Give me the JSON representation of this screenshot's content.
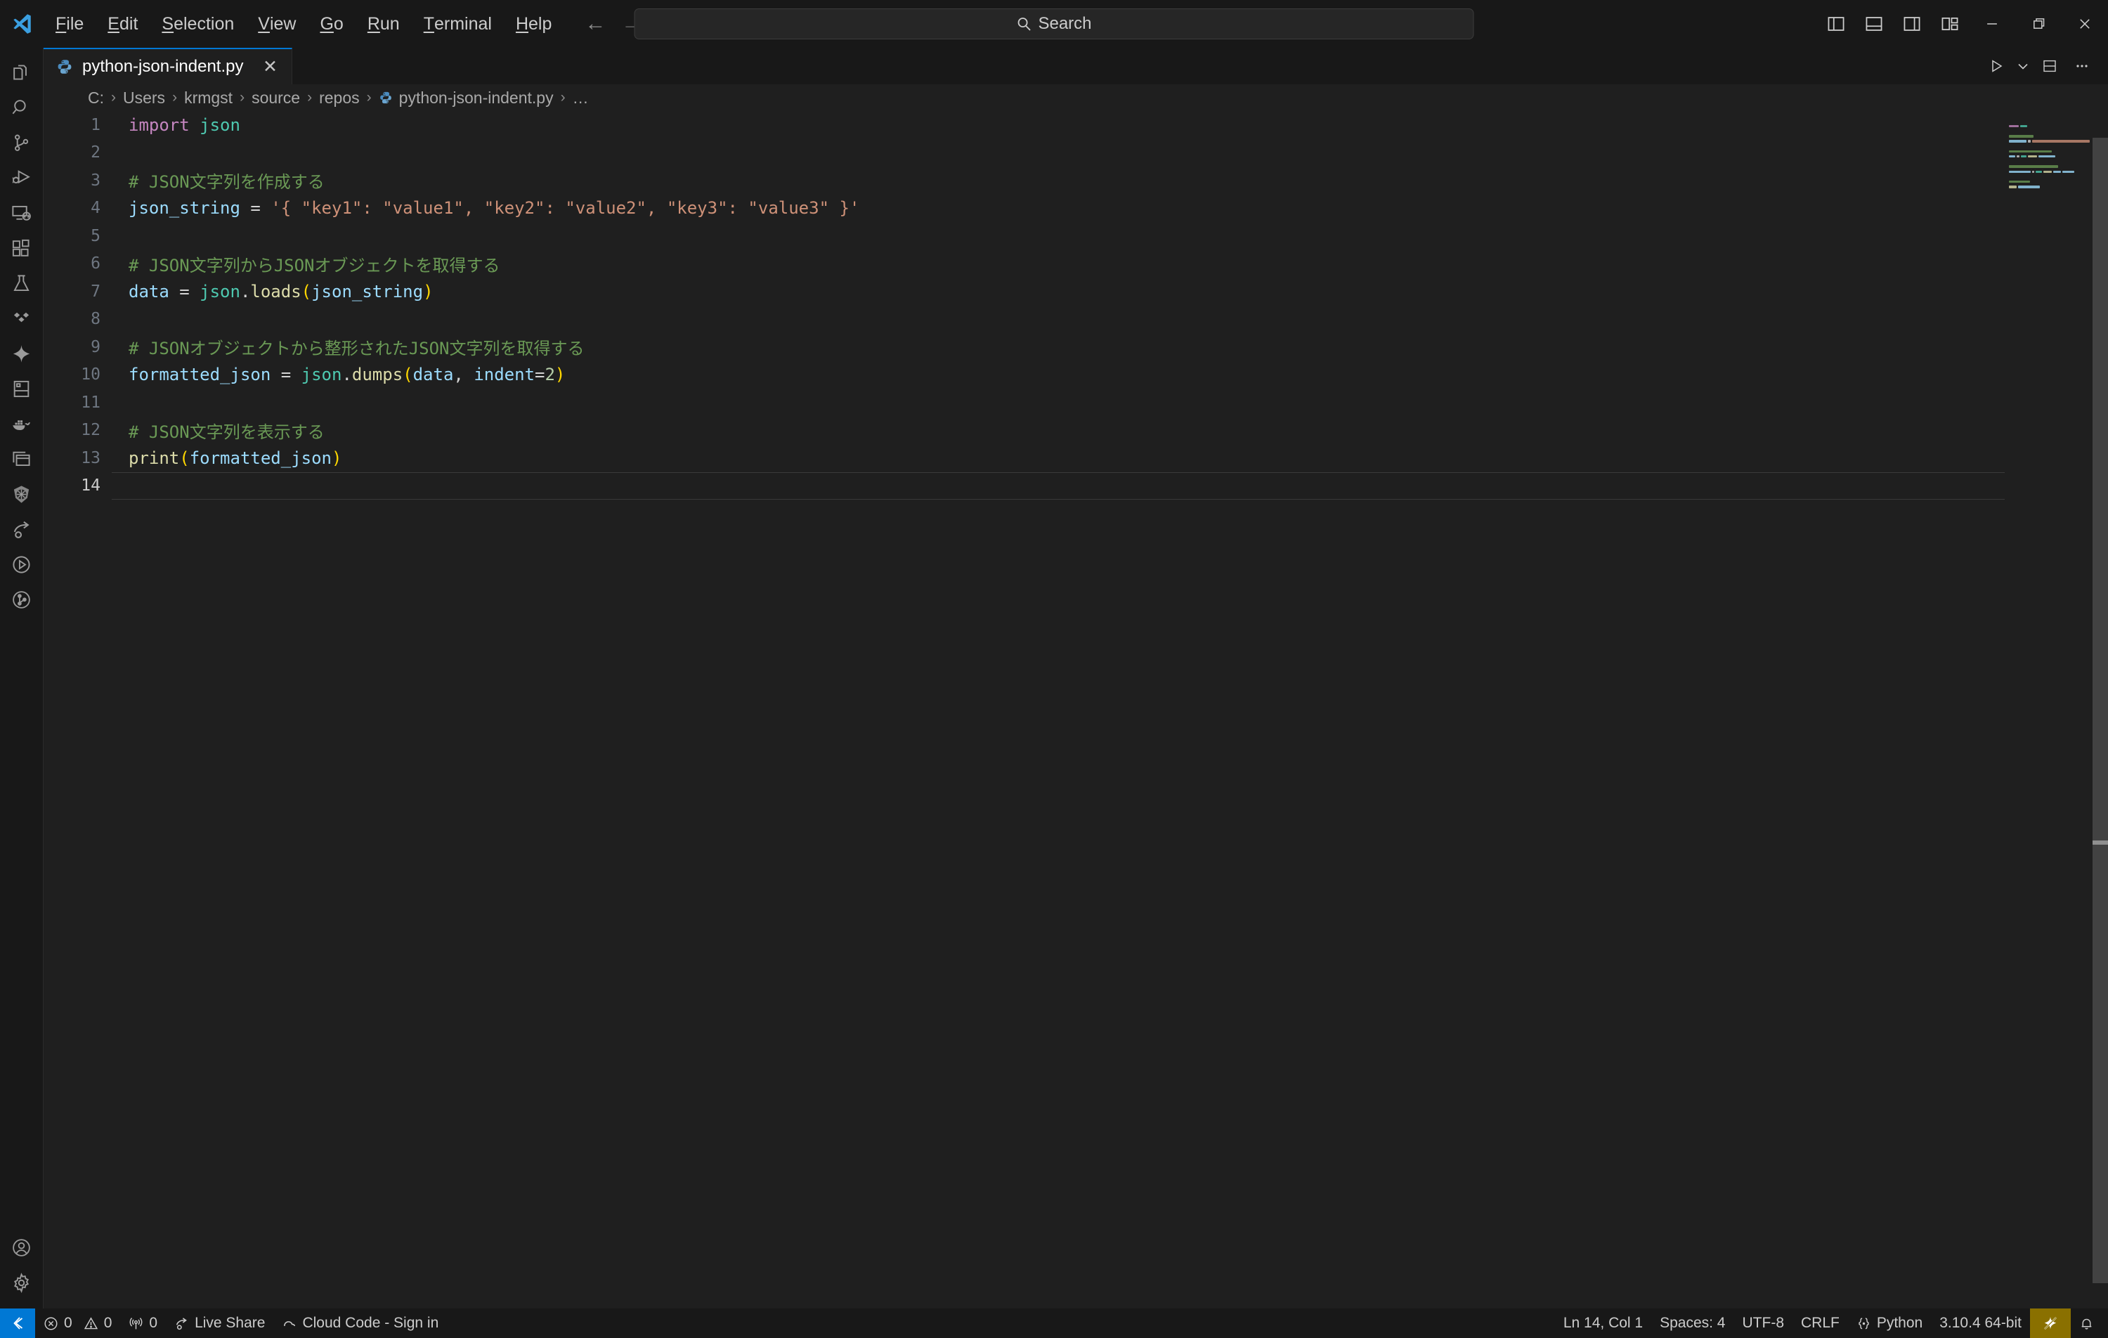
{
  "titlebar": {
    "logo_icon": "vscode-logo-icon",
    "menus": [
      {
        "label": "File",
        "mnemonic": "F"
      },
      {
        "label": "Edit",
        "mnemonic": "E"
      },
      {
        "label": "Selection",
        "mnemonic": "S"
      },
      {
        "label": "View",
        "mnemonic": "V"
      },
      {
        "label": "Go",
        "mnemonic": "G"
      },
      {
        "label": "Run",
        "mnemonic": "R"
      },
      {
        "label": "Terminal",
        "mnemonic": "T"
      },
      {
        "label": "Help",
        "mnemonic": "H"
      }
    ],
    "nav": {
      "back_icon": "arrow-left-icon",
      "forward_icon": "arrow-right-icon"
    },
    "search": {
      "placeholder": "Search",
      "icon": "search-icon"
    },
    "layout_buttons": [
      {
        "name": "toggle-primary-sidebar-icon",
        "tooltip": "Toggle Primary Side Bar"
      },
      {
        "name": "toggle-panel-icon",
        "tooltip": "Toggle Panel"
      },
      {
        "name": "toggle-secondary-sidebar-icon",
        "tooltip": "Toggle Secondary Side Bar"
      },
      {
        "name": "customize-layout-icon",
        "tooltip": "Customize Layout"
      }
    ],
    "window_controls": [
      {
        "name": "minimize-button",
        "glyph": "minimize"
      },
      {
        "name": "restore-button",
        "glyph": "restore"
      },
      {
        "name": "close-button",
        "glyph": "close"
      }
    ]
  },
  "activitybar": {
    "items": [
      {
        "name": "explorer",
        "icon": "files-icon"
      },
      {
        "name": "search",
        "icon": "search-icon"
      },
      {
        "name": "source-control",
        "icon": "source-control-icon"
      },
      {
        "name": "run-and-debug",
        "icon": "run-debug-icon"
      },
      {
        "name": "remote-explorer",
        "icon": "remote-explorer-icon"
      },
      {
        "name": "extensions",
        "icon": "extensions-icon"
      },
      {
        "name": "testing",
        "icon": "beaker-icon"
      },
      {
        "name": "azure",
        "icon": "azure-icon"
      },
      {
        "name": "copilot-chat",
        "icon": "sparkle-icon"
      },
      {
        "name": "database",
        "icon": "database-icon"
      },
      {
        "name": "docker",
        "icon": "docker-whale-icon"
      },
      {
        "name": "remote-windows",
        "icon": "windows-stack-icon"
      },
      {
        "name": "kubernetes",
        "icon": "kubernetes-helm-icon"
      },
      {
        "name": "live-share",
        "icon": "live-share-icon"
      },
      {
        "name": "test-coverage",
        "icon": "play-circle-icon"
      },
      {
        "name": "gitlens",
        "icon": "gitlens-icon"
      }
    ],
    "bottom_items": [
      {
        "name": "accounts",
        "icon": "account-icon"
      },
      {
        "name": "manage",
        "icon": "gear-icon"
      }
    ]
  },
  "tabbar": {
    "tabs": [
      {
        "label": "python-json-indent.py",
        "icon": "python-file-icon",
        "active": true,
        "close_icon": "close-icon"
      }
    ],
    "actions": [
      {
        "name": "run-python-file-button",
        "icon": "play-icon"
      },
      {
        "name": "run-options-dropdown",
        "icon": "chevron-down-icon"
      },
      {
        "name": "split-editor-button",
        "icon": "split-editor-down-icon"
      },
      {
        "name": "more-actions-button",
        "icon": "ellipsis-icon"
      }
    ]
  },
  "breadcrumb": {
    "separator": "›",
    "items": [
      {
        "label": "C:",
        "icon": null
      },
      {
        "label": "Users",
        "icon": null
      },
      {
        "label": "krmgst",
        "icon": null
      },
      {
        "label": "source",
        "icon": null
      },
      {
        "label": "repos",
        "icon": null
      },
      {
        "label": "python-json-indent.py",
        "icon": "python-file-icon"
      },
      {
        "label": "…",
        "icon": null
      }
    ]
  },
  "editor": {
    "language": "python",
    "active_line": 14,
    "lines": [
      {
        "n": 1,
        "tokens": [
          {
            "t": "import",
            "c": "kw"
          },
          {
            "t": " ",
            "c": "plain"
          },
          {
            "t": "json",
            "c": "mod"
          }
        ]
      },
      {
        "n": 2,
        "tokens": []
      },
      {
        "n": 3,
        "tokens": [
          {
            "t": "# JSON文字列を作成する",
            "c": "cmt"
          }
        ]
      },
      {
        "n": 4,
        "tokens": [
          {
            "t": "json_string",
            "c": "var"
          },
          {
            "t": " ",
            "c": "plain"
          },
          {
            "t": "=",
            "c": "op"
          },
          {
            "t": " ",
            "c": "plain"
          },
          {
            "t": "'{ \"key1\": \"value1\", \"key2\": \"value2\", \"key3\": \"value3\" }'",
            "c": "str"
          }
        ]
      },
      {
        "n": 5,
        "tokens": []
      },
      {
        "n": 6,
        "tokens": [
          {
            "t": "# JSON文字列からJSONオブジェクトを取得する",
            "c": "cmt"
          }
        ]
      },
      {
        "n": 7,
        "tokens": [
          {
            "t": "data",
            "c": "var"
          },
          {
            "t": " ",
            "c": "plain"
          },
          {
            "t": "=",
            "c": "op"
          },
          {
            "t": " ",
            "c": "plain"
          },
          {
            "t": "json",
            "c": "mod"
          },
          {
            "t": ".",
            "c": "plain"
          },
          {
            "t": "loads",
            "c": "fn"
          },
          {
            "t": "(",
            "c": "br"
          },
          {
            "t": "json_string",
            "c": "var"
          },
          {
            "t": ")",
            "c": "br"
          }
        ]
      },
      {
        "n": 8,
        "tokens": []
      },
      {
        "n": 9,
        "tokens": [
          {
            "t": "# JSONオブジェクトから整形されたJSON文字列を取得する",
            "c": "cmt"
          }
        ]
      },
      {
        "n": 10,
        "tokens": [
          {
            "t": "formatted_json",
            "c": "var"
          },
          {
            "t": " ",
            "c": "plain"
          },
          {
            "t": "=",
            "c": "op"
          },
          {
            "t": " ",
            "c": "plain"
          },
          {
            "t": "json",
            "c": "mod"
          },
          {
            "t": ".",
            "c": "plain"
          },
          {
            "t": "dumps",
            "c": "fn"
          },
          {
            "t": "(",
            "c": "br"
          },
          {
            "t": "data",
            "c": "var"
          },
          {
            "t": ", ",
            "c": "plain"
          },
          {
            "t": "indent",
            "c": "var"
          },
          {
            "t": "=",
            "c": "op"
          },
          {
            "t": "2",
            "c": "num"
          },
          {
            "t": ")",
            "c": "br"
          }
        ]
      },
      {
        "n": 11,
        "tokens": []
      },
      {
        "n": 12,
        "tokens": [
          {
            "t": "# JSON文字列を表示する",
            "c": "cmt"
          }
        ]
      },
      {
        "n": 13,
        "tokens": [
          {
            "t": "print",
            "c": "fn"
          },
          {
            "t": "(",
            "c": "br"
          },
          {
            "t": "formatted_json",
            "c": "var"
          },
          {
            "t": ")",
            "c": "br"
          }
        ]
      },
      {
        "n": 14,
        "tokens": []
      }
    ]
  },
  "statusbar": {
    "left": [
      {
        "name": "remote-host-indicator",
        "label": "",
        "icon": "remote-icon"
      },
      {
        "name": "problems-errors",
        "label": "0",
        "icon": "error-icon"
      },
      {
        "name": "problems-warnings",
        "label": "0",
        "icon": "warning-icon"
      },
      {
        "name": "ports-forwarded",
        "label": "0",
        "icon": "radio-tower-icon"
      },
      {
        "name": "live-share",
        "label": "Live Share",
        "icon": "live-share-icon"
      },
      {
        "name": "cloud-code",
        "label": "Cloud Code - Sign in",
        "icon": "cloud-icon"
      }
    ],
    "right": [
      {
        "name": "cursor-position",
        "label": "Ln 14, Col 1"
      },
      {
        "name": "indentation",
        "label": "Spaces: 4"
      },
      {
        "name": "encoding",
        "label": "UTF-8"
      },
      {
        "name": "eol-sequence",
        "label": "CRLF"
      },
      {
        "name": "language-mode",
        "label": "Python",
        "icon": "python-brackets-icon"
      },
      {
        "name": "python-interpreter",
        "label": "3.10.4 64-bit"
      },
      {
        "name": "copilot-status",
        "label": "",
        "icon": "copilot-disabled-icon"
      },
      {
        "name": "notifications",
        "label": "",
        "icon": "bell-icon"
      }
    ]
  },
  "colors": {
    "accent": "#0078d4",
    "titlebar_bg": "#181818",
    "editor_bg": "#1f1f1f",
    "copilot_warning_bg": "#8a7000"
  },
  "minimap": {
    "rows": [
      [
        {
          "w": 34,
          "color": "#c586c0"
        },
        {
          "w": 22,
          "color": "#4ec9b0"
        }
      ],
      [],
      [
        {
          "w": 84,
          "color": "#6a9955"
        }
      ],
      [
        {
          "w": 60,
          "color": "#9cdcfe"
        },
        {
          "w": 8,
          "color": "#d4d4d4"
        },
        {
          "w": 196,
          "color": "#ce9178"
        }
      ],
      [],
      [
        {
          "w": 146,
          "color": "#6a9955"
        }
      ],
      [
        {
          "w": 22,
          "color": "#9cdcfe"
        },
        {
          "w": 8,
          "color": "#d4d4d4"
        },
        {
          "w": 20,
          "color": "#4ec9b0"
        },
        {
          "w": 30,
          "color": "#dcdcaa"
        },
        {
          "w": 58,
          "color": "#9cdcfe"
        }
      ],
      [],
      [
        {
          "w": 166,
          "color": "#6a9955"
        }
      ],
      [
        {
          "w": 74,
          "color": "#9cdcfe"
        },
        {
          "w": 8,
          "color": "#d4d4d4"
        },
        {
          "w": 20,
          "color": "#4ec9b0"
        },
        {
          "w": 30,
          "color": "#dcdcaa"
        },
        {
          "w": 24,
          "color": "#9cdcfe"
        },
        {
          "w": 42,
          "color": "#9cdcfe"
        }
      ],
      [],
      [
        {
          "w": 72,
          "color": "#6a9955"
        }
      ],
      [
        {
          "w": 26,
          "color": "#dcdcaa"
        },
        {
          "w": 74,
          "color": "#9cdcfe"
        }
      ],
      []
    ]
  }
}
